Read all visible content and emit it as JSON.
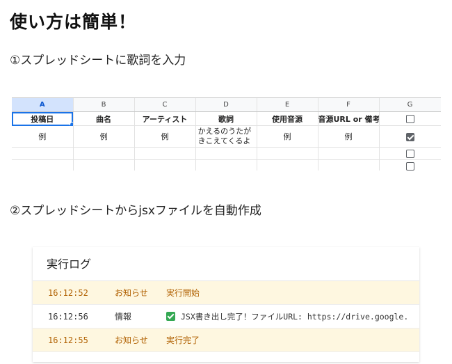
{
  "title": "使い方は簡単！",
  "step1": "①スプレッドシートに歌詞を入力",
  "step2": "②スプレッドシートからjsxファイルを自動作成",
  "sheet": {
    "columns": [
      "A",
      "B",
      "C",
      "D",
      "E",
      "F",
      "G"
    ],
    "headers": [
      "投稿日",
      "曲名",
      "アーティスト",
      "歌詞",
      "使用音源",
      "音源URL or 備考"
    ],
    "example_row": [
      "例",
      "例",
      "例",
      "かえるのうたがきこえてくるよ",
      "例",
      "例"
    ]
  },
  "log": {
    "title": "実行ログ",
    "rows": [
      {
        "time": "16:12:52",
        "level": "お知らせ",
        "message": "実行開始"
      },
      {
        "time": "16:12:56",
        "level": "情報",
        "message": "JSX書き出し完了！ファイルURL: https://drive.google."
      },
      {
        "time": "16:12:55",
        "level": "お知らせ",
        "message": "実行完了"
      }
    ]
  },
  "colors": {
    "notice_bg": "#fef7e0",
    "notice_text": "#b06000",
    "success_icon": "#34a853",
    "selection": "#1a73e8"
  }
}
